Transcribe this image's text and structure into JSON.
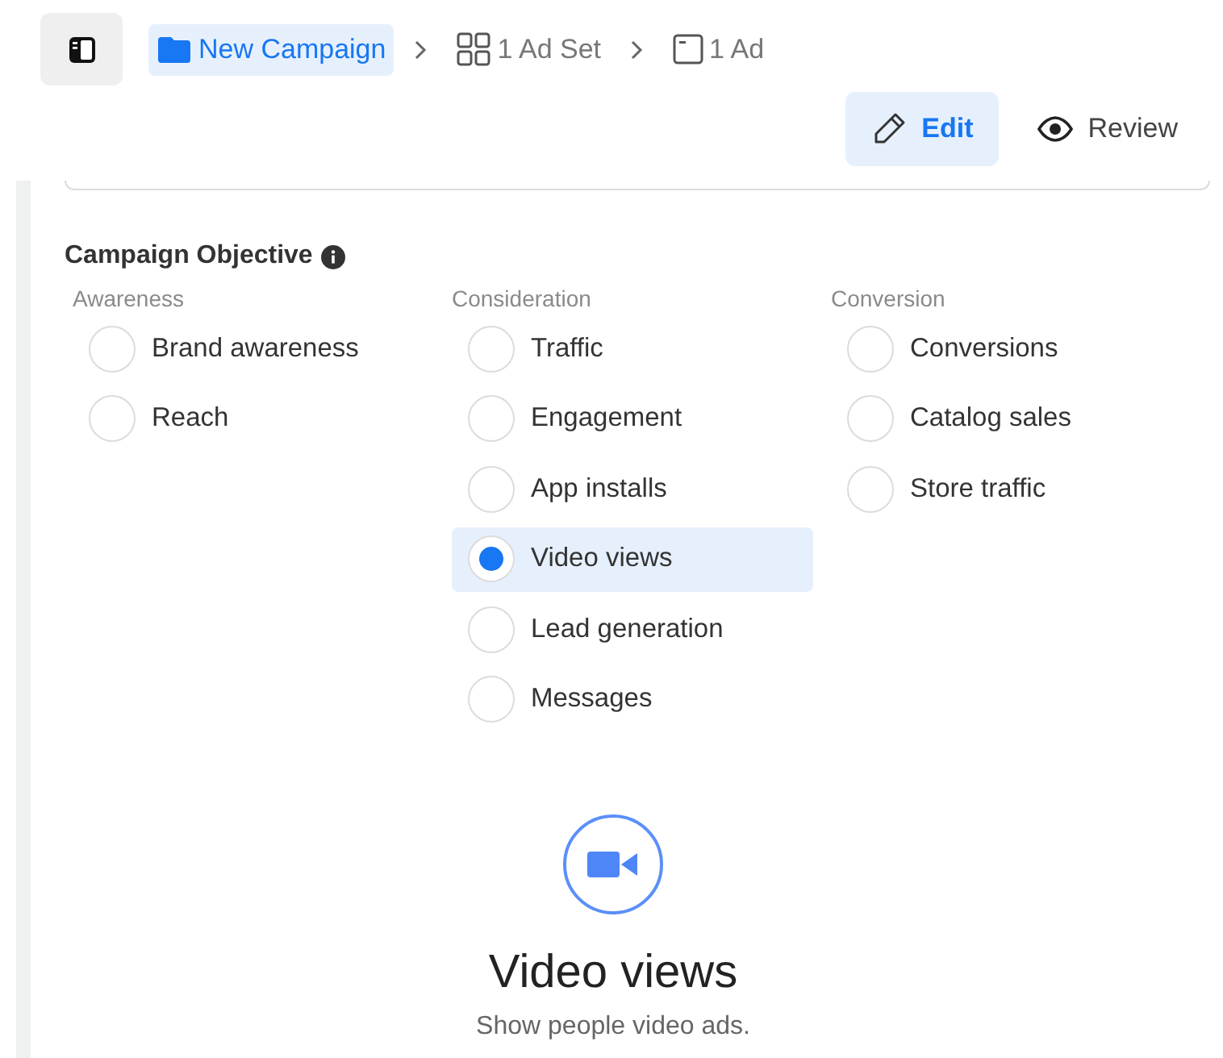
{
  "breadcrumb": [
    {
      "kind": "campaign",
      "label": "New Campaign",
      "selected": true
    },
    {
      "kind": "adset",
      "label": "1 Ad Set",
      "selected": false
    },
    {
      "kind": "ad",
      "label": "1 Ad",
      "selected": false
    }
  ],
  "modes": [
    {
      "kind": "edit",
      "label": "Edit",
      "selected": true
    },
    {
      "kind": "review",
      "label": "Review",
      "selected": false
    }
  ],
  "objective": {
    "title": "Campaign Objective",
    "groups": [
      {
        "heading": "Awareness",
        "options": [
          {
            "label": "Brand awareness",
            "selected": false
          },
          {
            "label": "Reach",
            "selected": false
          }
        ]
      },
      {
        "heading": "Consideration",
        "options": [
          {
            "label": "Traffic",
            "selected": false
          },
          {
            "label": "Engagement",
            "selected": false
          },
          {
            "label": "App installs",
            "selected": false
          },
          {
            "label": "Video views",
            "selected": true
          },
          {
            "label": "Lead generation",
            "selected": false
          },
          {
            "label": "Messages",
            "selected": false
          }
        ]
      },
      {
        "heading": "Conversion",
        "options": [
          {
            "label": "Conversions",
            "selected": false
          },
          {
            "label": "Catalog sales",
            "selected": false
          },
          {
            "label": "Store traffic",
            "selected": false
          }
        ]
      }
    ]
  },
  "detail": {
    "title": "Video views",
    "description": "Show people video ads."
  }
}
